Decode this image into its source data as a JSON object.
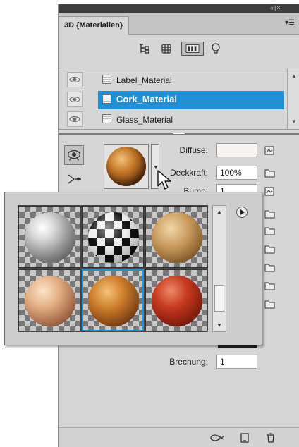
{
  "panel": {
    "controls": "«|×",
    "tab_title": "3D {Materialien}",
    "flyout_glyph": "▾☰"
  },
  "toolbar": {
    "icons": [
      "scene-tree-icon",
      "mesh-icon",
      "materials-icon",
      "light-icon"
    ]
  },
  "materials": [
    {
      "label": "Label_Material",
      "selected": false
    },
    {
      "label": "Cork_Material",
      "selected": true
    },
    {
      "label": "Glass_Material",
      "selected": false
    }
  ],
  "properties": {
    "diffuse_label": "Diffuse:",
    "opacity_label": "Deckkraft:",
    "opacity_value": "100%",
    "bump_label": "Bump:",
    "bump_value": "1",
    "refraction_label": "Brechung:",
    "refraction_value": "1"
  },
  "picker": {
    "presets": [
      "chrome",
      "checker",
      "cork-light",
      "wood",
      "cork",
      "red-plastic"
    ],
    "selected_index": 4
  },
  "colors": {
    "selection": "#1f8fd6",
    "panel_bg": "#d6d6d6"
  }
}
